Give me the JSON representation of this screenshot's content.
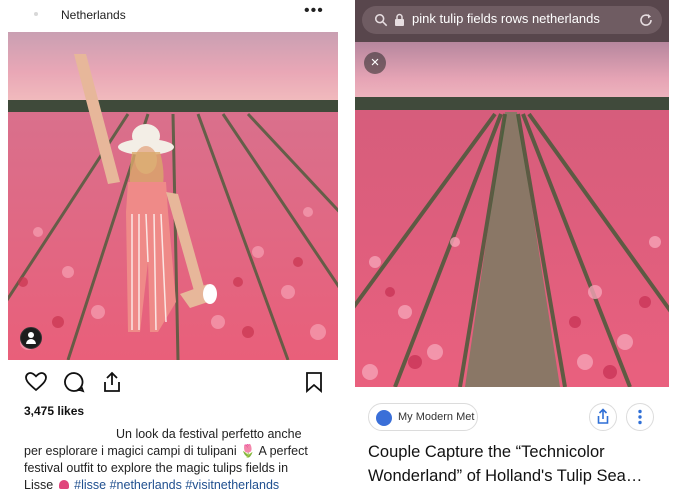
{
  "instagram": {
    "location": "Netherlands",
    "more_icon": "more-horizontal-icon",
    "likes": "3,475 likes",
    "caption": {
      "line1": "Un look da festival perfetto anche",
      "line2": "per esplorare i magici campi di tulipani",
      "line3_tail": "A perfect",
      "line4": "festival outfit to explore the magic tulips fields in",
      "line5_start": "Lisse",
      "hashtags": "#lisse #netherlands #visitnetherlands"
    },
    "actions": [
      "heart-icon",
      "comment-icon",
      "share-icon",
      "bookmark-icon"
    ]
  },
  "search": {
    "query": "pink tulip fields rows netherlands",
    "close_label": "×",
    "source": "My Modern Met",
    "result_title_line1": "Couple Capture the “Technicolor",
    "result_title_line2": "Wonderland” of Holland's Tulip Sea…"
  },
  "colors": {
    "tulip_pink": "#e8607e",
    "sky_pink": "#f2a9b8",
    "hashtag_blue": "#1f4f8f",
    "searchbar_bg": "#58464c"
  }
}
